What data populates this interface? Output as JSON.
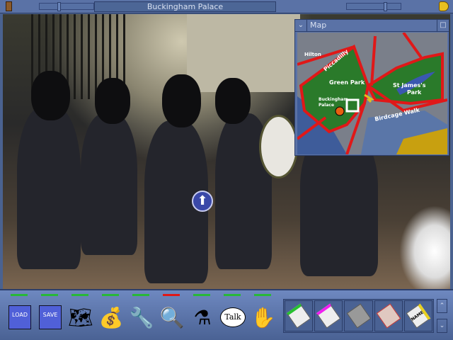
{
  "window": {
    "title": "Buckingham Palace",
    "left_icon": "door-icon",
    "right_icon": "bell-icon"
  },
  "scene": {
    "description_icon": "nav-forward-arrow-icon",
    "arrow": "⬆"
  },
  "map": {
    "title": "Map",
    "collapse": "⌄",
    "maximize": "□",
    "labels": {
      "hilton": "Hilton",
      "piccadilly": "Piccadilly",
      "green_park": "Green Park",
      "st_james": "St James's",
      "park": "Park",
      "buckingham": "Buckingham",
      "palace": "Palace",
      "birdcage": "Birdcage Walk"
    }
  },
  "toolbar": {
    "indicators": [
      "green",
      "green",
      "green",
      "green",
      "green",
      "red",
      "green",
      "green",
      "green"
    ],
    "tools": [
      {
        "name": "load",
        "label": "LOAD",
        "icon": "load-disk-icon"
      },
      {
        "name": "save",
        "label": "SAVE",
        "icon": "save-disk-icon"
      },
      {
        "name": "map",
        "icon": "map-icon",
        "glyph": "🗺"
      },
      {
        "name": "money",
        "icon": "money-bag-icon",
        "glyph": "💰"
      },
      {
        "name": "use",
        "icon": "wrench-icon",
        "glyph": "🔧"
      },
      {
        "name": "examine",
        "icon": "magnifier-icon",
        "glyph": "🔍"
      },
      {
        "name": "combine",
        "icon": "flask-icon",
        "glyph": "⚗"
      },
      {
        "name": "talk",
        "label": "Talk",
        "icon": "speech-bubble-icon"
      },
      {
        "name": "take",
        "icon": "hand-icon",
        "glyph": "✋"
      }
    ],
    "inventory": [
      {
        "icon": "note-green-icon",
        "color": "#28c030"
      },
      {
        "icon": "note-magenta-icon",
        "color": "#f020f0"
      },
      {
        "icon": "newspaper-icon",
        "color": "#888888"
      },
      {
        "icon": "torn-paper-icon",
        "color": "#c03030"
      },
      {
        "icon": "name-card-icon",
        "color": "#e8d020",
        "label": "NAME"
      }
    ],
    "scroll_up": "⌃",
    "scroll_down": "⌄"
  }
}
